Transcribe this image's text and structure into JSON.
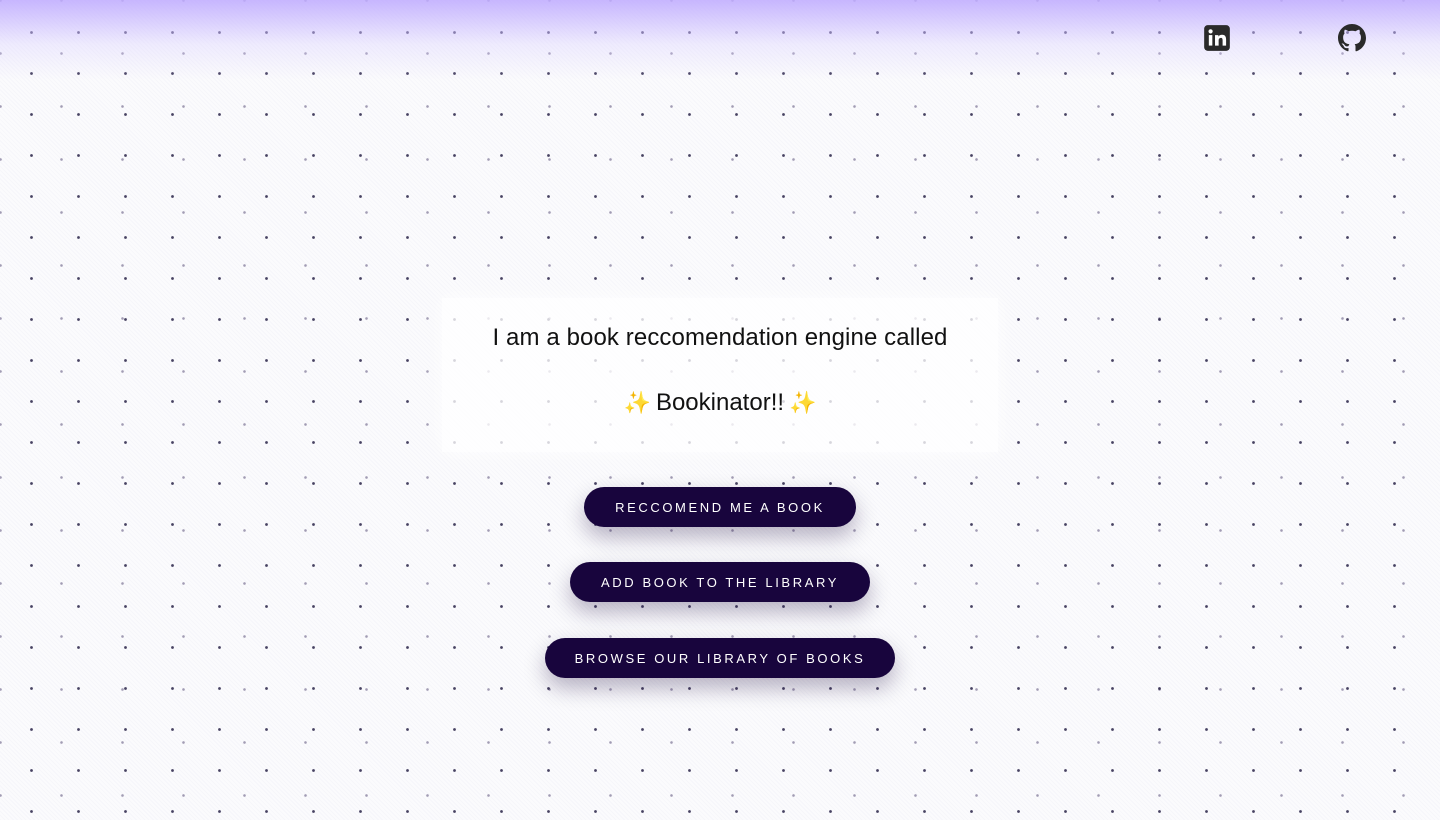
{
  "header": {
    "links": [
      {
        "icon": "linkedin-icon",
        "label": "LinkedIn"
      },
      {
        "icon": "github-icon",
        "label": "GitHub"
      }
    ]
  },
  "intro": {
    "text": "I am a book reccomendation engine called",
    "sparkle": "✨",
    "app_name": "Bookinator!!"
  },
  "actions": {
    "recommend_label": "RECCOMEND ME A BOOK",
    "add_label": "ADD BOOK TO THE LIBRARY",
    "browse_label": "BROWSE OUR LIBRARY OF BOOKS"
  },
  "colors": {
    "button_bg": "#18053d",
    "button_text": "#ffffff",
    "glow": "#c4b5fd",
    "sparkle": "#f2c94c"
  }
}
